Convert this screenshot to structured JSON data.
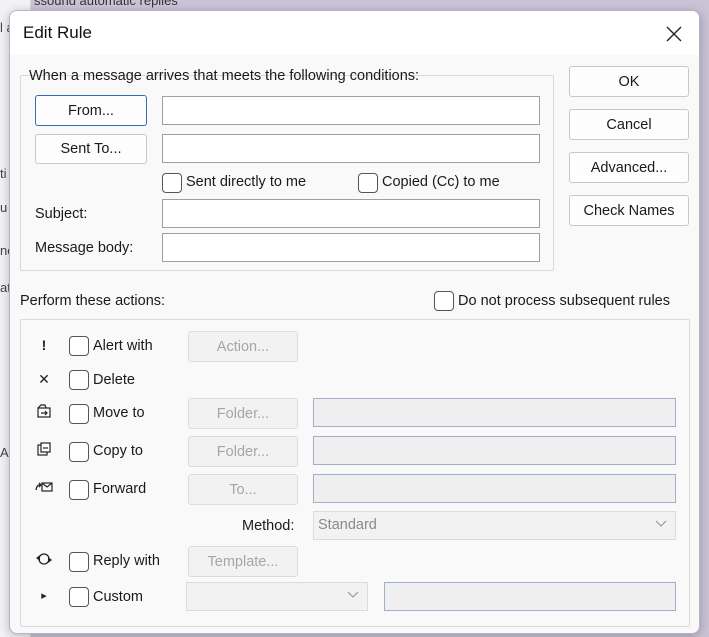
{
  "background": {
    "top_text": "ssound automatic replies",
    "left_fragments": [
      "l a",
      "ti",
      "u",
      "ne",
      "at",
      "A"
    ]
  },
  "dialog": {
    "title": "Edit Rule",
    "conditions": {
      "heading": "When a message arrives that meets the following conditions:",
      "from_label": "From...",
      "from_value": "",
      "sent_to_label": "Sent To...",
      "sent_to_value": "",
      "sent_directly_label": "Sent directly to me",
      "copied_label": "Copied (Cc) to me",
      "subject_label": "Subject:",
      "subject_value": "",
      "body_label": "Message body:",
      "body_value": ""
    },
    "side_buttons": {
      "ok": "OK",
      "cancel": "Cancel",
      "advanced": "Advanced...",
      "check_names": "Check Names"
    },
    "actions": {
      "heading": "Perform these actions:",
      "do_not_process_label": "Do not process subsequent rules",
      "alert": {
        "icon": "!",
        "label": "Alert with",
        "button": "Action..."
      },
      "delete": {
        "icon": "✕",
        "label": "Delete"
      },
      "move": {
        "label": "Move to",
        "button": "Folder..."
      },
      "copy": {
        "label": "Copy to",
        "button": "Folder..."
      },
      "forward": {
        "label": "Forward",
        "button": "To..."
      },
      "method": {
        "label": "Method:",
        "value": "Standard"
      },
      "reply": {
        "label": "Reply with",
        "button": "Template..."
      },
      "custom": {
        "icon": "▸",
        "label": "Custom",
        "value": ""
      }
    }
  }
}
